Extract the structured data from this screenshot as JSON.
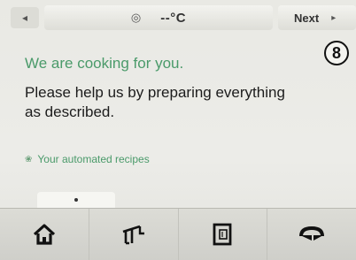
{
  "topbar": {
    "back_label": "◂",
    "timer_icon": "timer-icon",
    "temperature": "--°C",
    "next_label": "Next",
    "next_arrow": "▸"
  },
  "step": {
    "number": "8"
  },
  "content": {
    "title": "We are cooking for you.",
    "message": "Please help us by preparing everything as described.",
    "recipes_link": "Your automated recipes"
  },
  "bottom_nav": [
    {
      "icon": "home-icon"
    },
    {
      "icon": "scale-icon"
    },
    {
      "icon": "recipe-book-icon"
    },
    {
      "icon": "turbo-icon"
    }
  ],
  "colors": {
    "accent_green": "#4a9a6a",
    "text_dark": "#1c1c1c",
    "background": "#ecece8"
  }
}
